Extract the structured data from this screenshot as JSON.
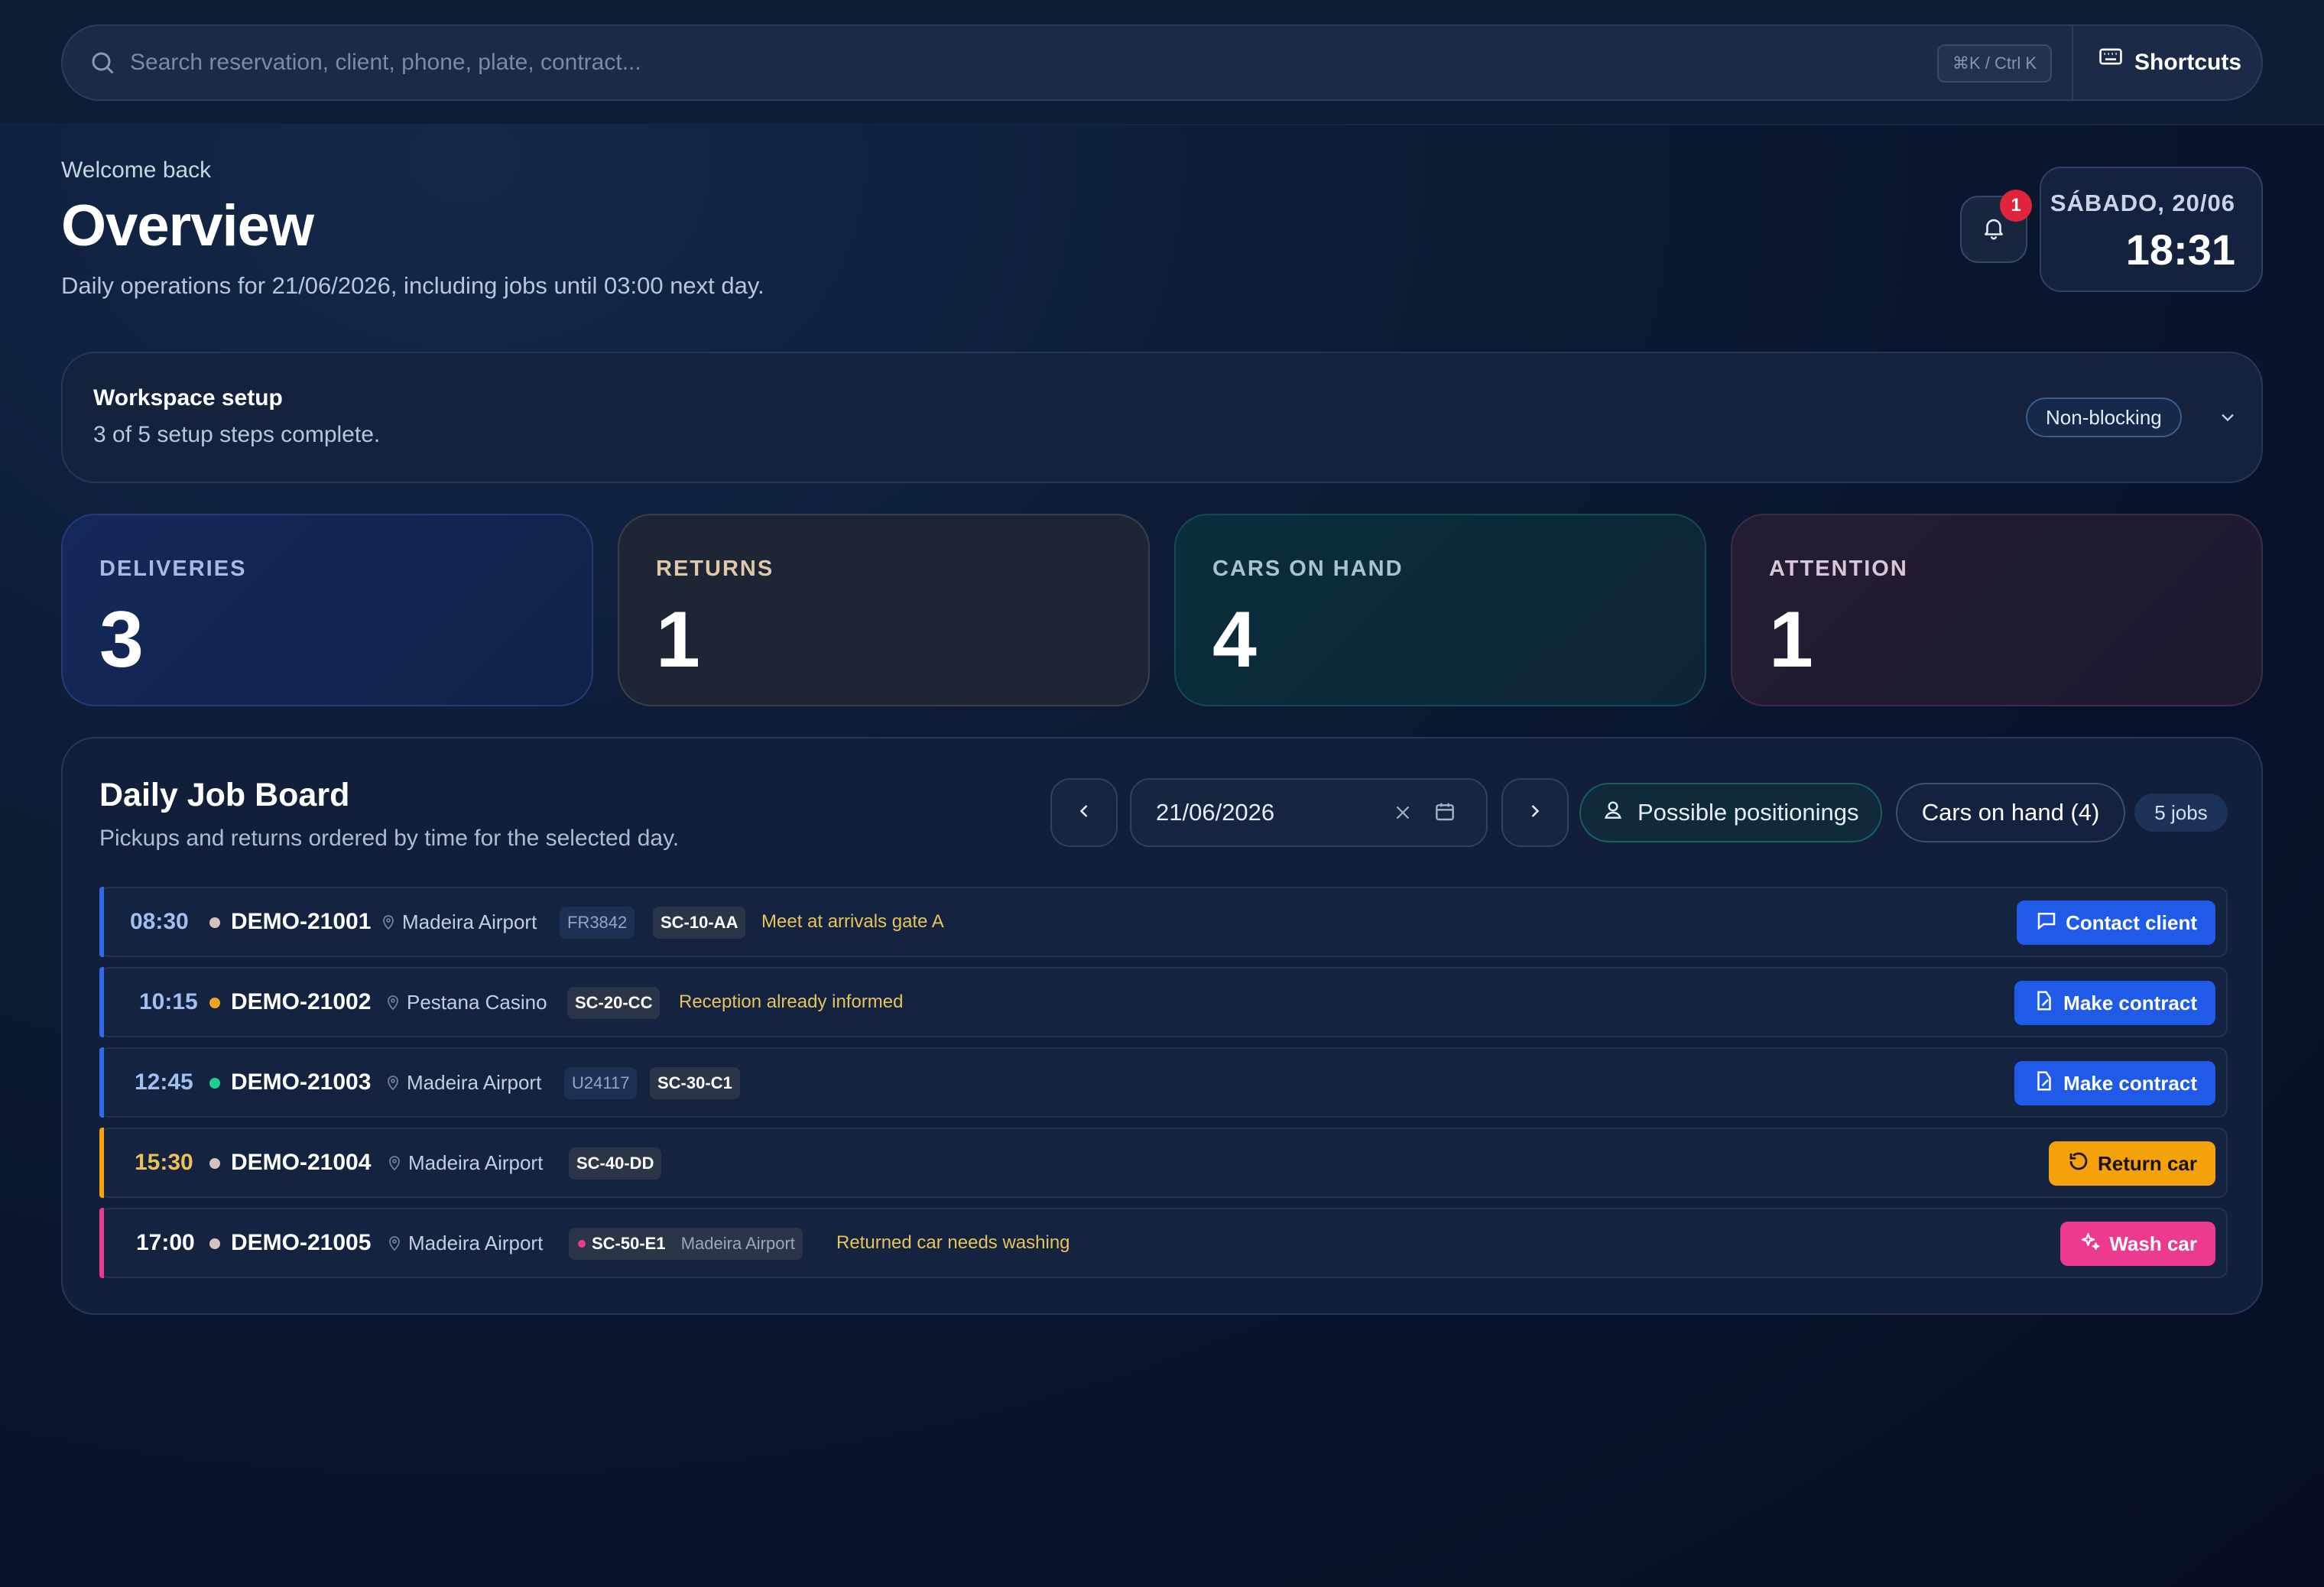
{
  "search": {
    "placeholder": "Search reservation, client, phone, plate, contract...",
    "kbd_hint": "⌘K / Ctrl K",
    "shortcuts_label": "Shortcuts"
  },
  "header": {
    "welcome": "Welcome back",
    "title": "Overview",
    "subtitle": "Daily operations for 21/06/2026, including jobs until 03:00 next day.",
    "notification_count": "1",
    "clock_day": "SÁBADO, 20/06",
    "clock_time": "18:31"
  },
  "setup": {
    "title": "Workspace setup",
    "status": "3 of 5 setup steps complete.",
    "badge": "Non-blocking"
  },
  "stats": [
    {
      "label": "DELIVERIES",
      "value": "3"
    },
    {
      "label": "RETURNS",
      "value": "1"
    },
    {
      "label": "CARS ON HAND",
      "value": "4"
    },
    {
      "label": "ATTENTION",
      "value": "1"
    }
  ],
  "board": {
    "title": "Daily Job Board",
    "subtitle": "Pickups and returns ordered by time for the selected day.",
    "date": "21/06/2026",
    "positionings_label": "Possible positionings",
    "cars_on_hand_label": "Cars on hand (4)",
    "jobs_count": "5 jobs",
    "rows": [
      {
        "time": "08:30",
        "ref": "DEMO-21001",
        "location": "Madeira Airport",
        "flight": "FR3842",
        "plate": "SC-10-AA",
        "note": "Meet at arrivals gate A",
        "action": "Contact client"
      },
      {
        "time": "10:15",
        "ref": "DEMO-21002",
        "location": "Pestana Casino",
        "plate": "SC-20-CC",
        "note": "Reception already informed",
        "action": "Make contract"
      },
      {
        "time": "12:45",
        "ref": "DEMO-21003",
        "location": "Madeira Airport",
        "flight": "U24117",
        "plate": "SC-30-C1",
        "action": "Make contract"
      },
      {
        "time": "15:30",
        "ref": "DEMO-21004",
        "location": "Madeira Airport",
        "plate": "SC-40-DD",
        "action": "Return car"
      },
      {
        "time": "17:00",
        "ref": "DEMO-21005",
        "location": "Madeira Airport",
        "plate": "SC-50-E1",
        "plate_location": "Madeira Airport",
        "note": "Returned car needs washing",
        "action": "Wash car"
      }
    ]
  },
  "colors": {
    "delivery_accent": "#2f6be8",
    "return_accent": "#f5a20a",
    "wash_accent": "#ec3b8f",
    "time_blue": "#9fc0f2",
    "time_amber": "#eec05a"
  }
}
